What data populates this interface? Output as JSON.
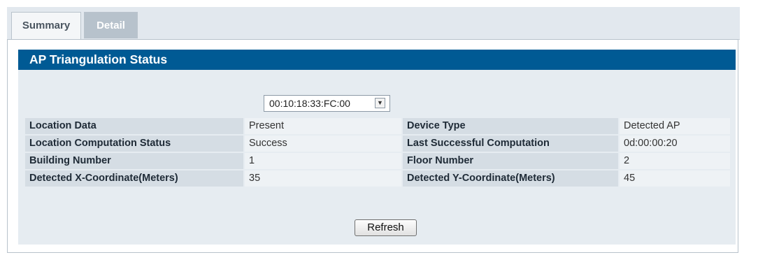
{
  "tabs": [
    {
      "label": "Summary",
      "active": false
    },
    {
      "label": "Detail",
      "active": true
    }
  ],
  "panel": {
    "title": "AP Triangulation Status"
  },
  "mac_select": {
    "selected": "00:10:18:33:FC:00"
  },
  "rows": [
    {
      "label1": "Location Data",
      "value1": "Present",
      "label2": "Device Type",
      "value2": "Detected AP"
    },
    {
      "label1": "Location Computation Status",
      "value1": "Success",
      "label2": "Last Successful Computation",
      "value2": "0d:00:00:20"
    },
    {
      "label1": "Building Number",
      "value1": "1",
      "label2": "Floor Number",
      "value2": "2"
    },
    {
      "label1": "Detected X-Coordinate(Meters)",
      "value1": "35",
      "label2": "Detected Y-Coordinate(Meters)",
      "value2": "45"
    }
  ],
  "buttons": {
    "refresh_label": "Refresh"
  },
  "colors": {
    "header_bg": "#005a94",
    "body_bg": "#e6ecf1",
    "label_bg": "#d5dde4"
  }
}
